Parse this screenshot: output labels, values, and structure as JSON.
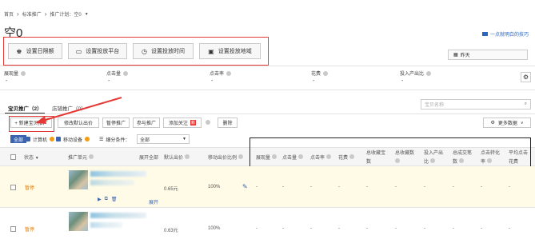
{
  "breadcrumb": {
    "home": "首页",
    "sep1": "›",
    "section": "标准推广",
    "sep2": "›",
    "plan": "推广计划：空0",
    "caret": "▼"
  },
  "page_title": "空0",
  "guide_link": "一点就明白的技巧",
  "settings_buttons": [
    {
      "icon": "♚",
      "label": "设置日限额"
    },
    {
      "icon": "▭",
      "label": "设置投放平台"
    },
    {
      "icon": "◷",
      "label": "设置投放时间"
    },
    {
      "icon": "▣",
      "label": "设置投放地域"
    }
  ],
  "date_select": {
    "icon": "▦",
    "value": "昨天"
  },
  "metrics": [
    {
      "label": "展现量",
      "value": "-"
    },
    {
      "label": "点击量",
      "value": "-"
    },
    {
      "label": "点击率",
      "value": "-"
    },
    {
      "label": "花费",
      "value": "-"
    },
    {
      "label": "投入产出比",
      "value": "-"
    }
  ],
  "tabs": [
    {
      "label": "宝贝推广（2）"
    },
    {
      "label": "店铺推广（0）"
    }
  ],
  "search_placeholder": "宝贝名称",
  "toolbar": {
    "new_promo": "+ 新建宝贝推广",
    "modify_bid": "修改默认出价",
    "pause": "暂停推广",
    "join": "参与推广",
    "add_follow": "添加关注",
    "follow_badge": "新",
    "delete": "删除",
    "more_data": "更多数据"
  },
  "filters": {
    "label_all": "全部",
    "computer": "计算机",
    "mobile": "移动设备",
    "segment": "细分条件：",
    "segment_value": "全部"
  },
  "table_headers": {
    "status": "状态",
    "unit": "推广单元",
    "unit_right": "展开全部",
    "bid": "默认出价",
    "bid_ratio": "移动出价比例",
    "impressions": "展现量",
    "clicks": "点击量",
    "ctr": "点击率",
    "cost": "花费",
    "fav_total1": "总收藏宝",
    "fav_total2": "数",
    "fav_shop": "总收藏数",
    "roi1": "投入产出",
    "roi2": "比",
    "deals1": "总成交笔",
    "deals2": "数",
    "conv1": "点击转化",
    "conv2": "率",
    "avg1": "平均点击",
    "avg2": "花费"
  },
  "rows": [
    {
      "status": "暂停",
      "bid": "0.65元",
      "ratio": "100%",
      "expand": "展开",
      "dash": "-"
    },
    {
      "status": "暂停",
      "bid": "0.63元",
      "ratio": "100%",
      "dash": "-"
    }
  ]
}
